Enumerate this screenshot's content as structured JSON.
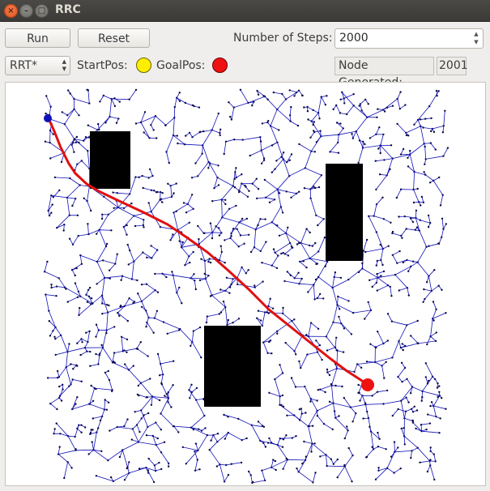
{
  "window": {
    "title": "RRC",
    "close_glyph": "×",
    "min_glyph": "–",
    "max_glyph": "□"
  },
  "toolbar": {
    "run_label": "Run",
    "reset_label": "Reset",
    "steps_label": "Number of Steps:",
    "steps_value": "2000",
    "algorithm_value": "RRT*",
    "start_label": "StartPos:",
    "goal_label": "GoalPos:",
    "nodes_label": "Node Generated:",
    "nodes_value": "2001"
  },
  "colors": {
    "start": "#ffee00",
    "goal": "#ee1111",
    "tree": "#1010b8",
    "path": "#e01010",
    "obstacle": "#000000"
  },
  "icons": [
    "close-icon",
    "minimize-icon",
    "maximize-icon",
    "spin-arrows-icon",
    "dropdown-arrows-icon"
  ]
}
